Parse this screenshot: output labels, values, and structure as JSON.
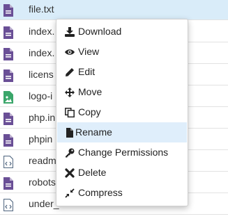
{
  "files": [
    {
      "name": "file.txt",
      "type": "doc",
      "selected": true
    },
    {
      "name": "index.",
      "type": "doc"
    },
    {
      "name": "index.",
      "type": "doc"
    },
    {
      "name": "licens",
      "type": "doc"
    },
    {
      "name": "logo-i",
      "type": "image"
    },
    {
      "name": "php.in",
      "type": "doc"
    },
    {
      "name": "phpin",
      "type": "doc"
    },
    {
      "name": "readm",
      "type": "code"
    },
    {
      "name": "robots",
      "type": "doc"
    },
    {
      "name": "under_",
      "type": "code"
    }
  ],
  "context_menu": {
    "items": [
      {
        "label": "Download",
        "icon": "download-icon"
      },
      {
        "label": "View",
        "icon": "eye-icon"
      },
      {
        "label": "Edit",
        "icon": "pencil-icon"
      },
      {
        "label": "Move",
        "icon": "move-arrows-icon"
      },
      {
        "label": "Copy",
        "icon": "copy-icon"
      },
      {
        "label": "Rename",
        "icon": "file-icon",
        "hovered": true
      },
      {
        "label": "Change Permissions",
        "icon": "key-icon"
      },
      {
        "label": "Delete",
        "icon": "x-icon"
      },
      {
        "label": "Compress",
        "icon": "compress-icon"
      }
    ]
  },
  "colors": {
    "doc_icon": "#6a4f96",
    "image_icon": "#3aa66a",
    "code_icon": "#5b6f87",
    "selected_row": "#d9ecf9",
    "hover_item": "#dfeefb"
  }
}
